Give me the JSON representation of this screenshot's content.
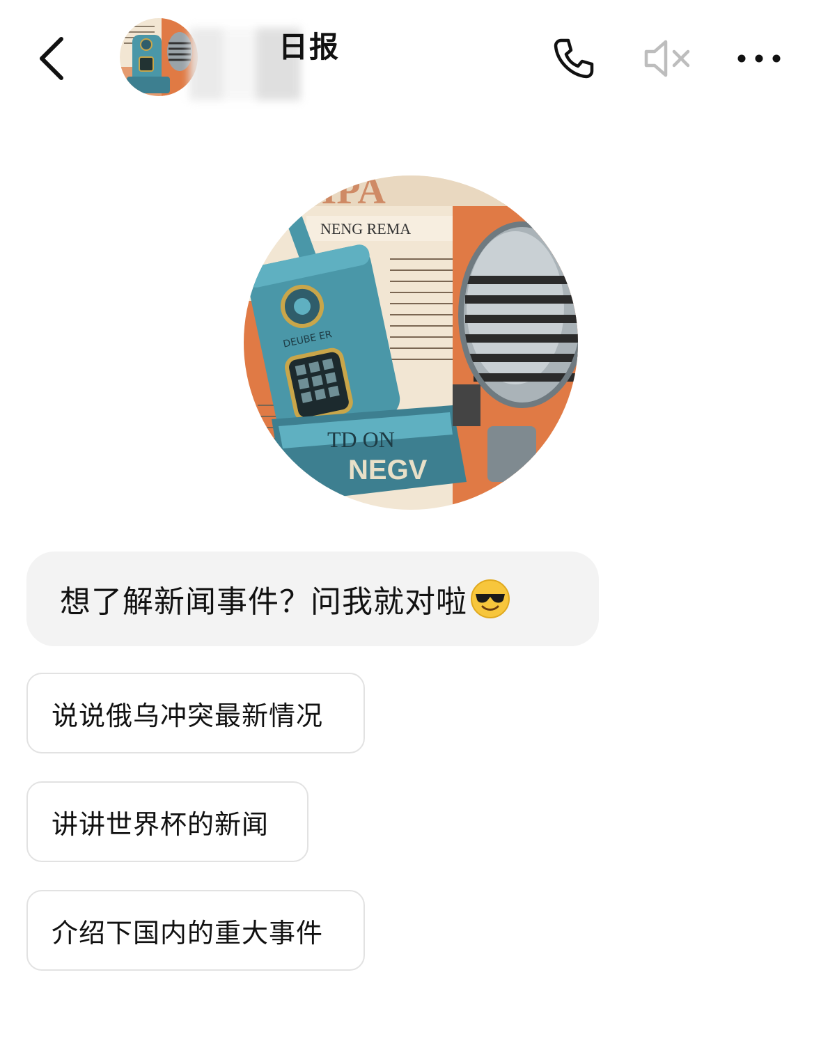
{
  "header": {
    "title": "日报",
    "icons": {
      "back": "chevron-left-icon",
      "phone": "phone-icon",
      "mute": "speaker-muted-icon",
      "more": "more-horizontal-icon"
    }
  },
  "avatar": {
    "label_top": "NENG REMA",
    "label_bottom": "NEGV"
  },
  "greeting": {
    "text": "想了解新闻事件？问我就对啦",
    "emoji": "sunglasses-face-emoji"
  },
  "suggestions": [
    {
      "label": "说说俄乌冲突最新情况"
    },
    {
      "label": "讲讲世界杯的新闻"
    },
    {
      "label": "介绍下国内的重大事件"
    }
  ],
  "colors": {
    "bubble_bg": "#f3f3f3",
    "chip_border": "#e2e2e2",
    "avatar_teal": "#4a97a8",
    "avatar_orange": "#e07a45",
    "avatar_paper": "#f2e6d3"
  }
}
